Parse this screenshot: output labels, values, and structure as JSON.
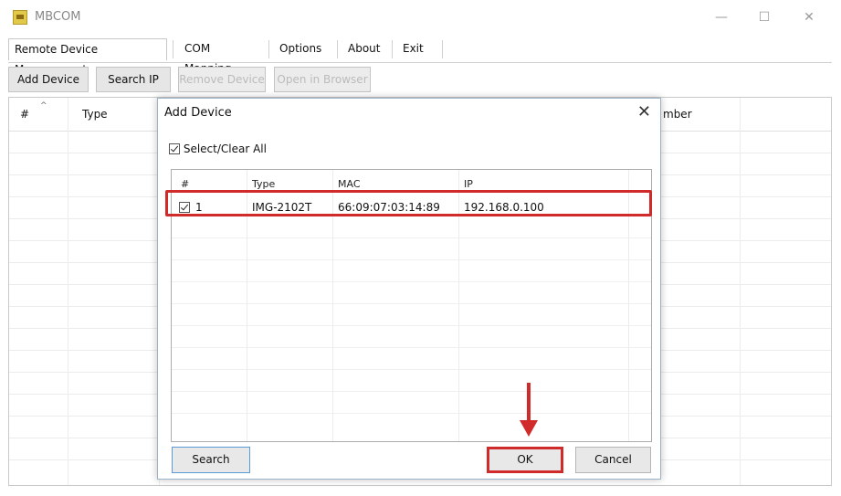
{
  "window": {
    "title": "MBCOM",
    "minimize": "—",
    "maximize": "☐",
    "close": "✕"
  },
  "menu": {
    "items": [
      "Remote Device Management",
      "COM Mapping",
      "Options",
      "About",
      "Exit"
    ]
  },
  "toolbar": {
    "add_device": "Add Device",
    "search_ip": "Search IP",
    "remove_device": "Remove Device",
    "open_in_browser": "Open in Browser"
  },
  "main_table": {
    "headers": [
      "#",
      "Type",
      "mber"
    ]
  },
  "dialog": {
    "title": "Add Device",
    "close": "✕",
    "select_all_label": "Select/Clear All",
    "columns": [
      "#",
      "Type",
      "MAC",
      "IP"
    ],
    "rows": [
      {
        "checked": true,
        "num": "1",
        "type": "IMG-2102T",
        "mac": "66:09:07:03:14:89",
        "ip": "192.168.0.100"
      }
    ],
    "search_label": "Search",
    "ok_label": "OK",
    "cancel_label": "Cancel"
  },
  "colors": {
    "highlight": "#d12a2a",
    "focus": "#5b9bd5"
  }
}
